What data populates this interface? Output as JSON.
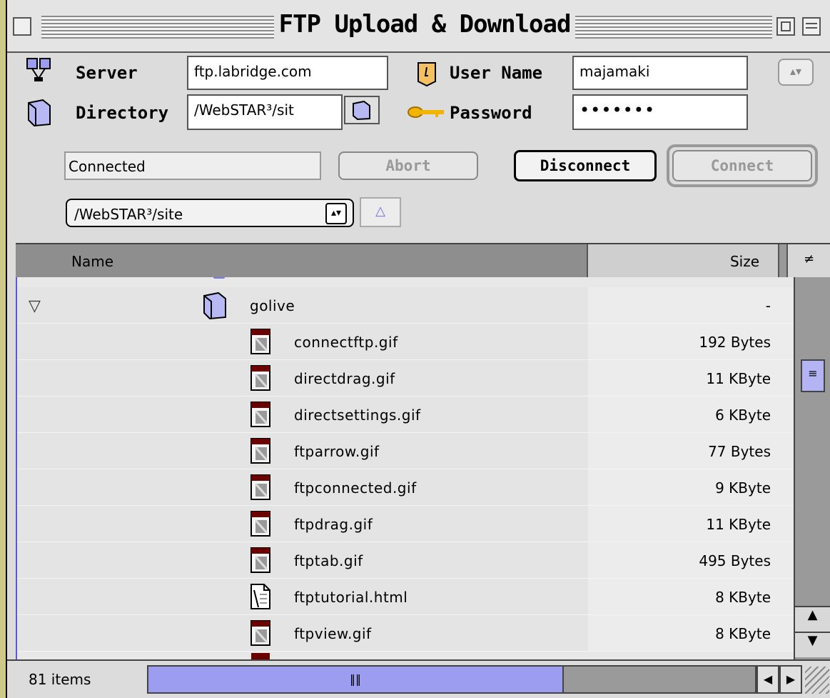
{
  "window": {
    "title": "FTP Upload & Download"
  },
  "form": {
    "server_label": "Server",
    "server_value": "ftp.labridge.com",
    "directory_label": "Directory",
    "directory_value": "/WebSTAR³/sit",
    "username_label": "User Name",
    "username_value": "majamaki",
    "password_label": "Password",
    "password_value": "•••••••"
  },
  "status_text": "Connected",
  "buttons": {
    "abort": "Abort",
    "disconnect": "Disconnect",
    "connect": "Connect"
  },
  "path_popup": "/WebSTAR³/site",
  "columns": {
    "name": "Name",
    "size": "Size"
  },
  "folder": {
    "name": "golive",
    "size": "-"
  },
  "files": [
    {
      "name": "connectftp.gif",
      "size": "192 Bytes",
      "icon": "gif-file-icon"
    },
    {
      "name": "directdrag.gif",
      "size": "11 KByte",
      "icon": "gif-file-icon"
    },
    {
      "name": "directsettings.gif",
      "size": "6 KByte",
      "icon": "gif-file-icon"
    },
    {
      "name": "ftparrow.gif",
      "size": "77 Bytes",
      "icon": "gif-file-icon"
    },
    {
      "name": "ftpconnected.gif",
      "size": "9 KByte",
      "icon": "gif-file-icon"
    },
    {
      "name": "ftpdrag.gif",
      "size": "11 KByte",
      "icon": "gif-file-icon"
    },
    {
      "name": "ftptab.gif",
      "size": "495 Bytes",
      "icon": "gif-file-icon"
    },
    {
      "name": "ftptutorial.html",
      "size": "8 KByte",
      "icon": "html-file-icon"
    },
    {
      "name": "ftpview.gif",
      "size": "8 KByte",
      "icon": "gif-file-icon"
    }
  ],
  "status_bar": {
    "items_count": "81 items"
  },
  "colors": {
    "accent": "#9c9cf0",
    "desktop": "#cfc88a"
  }
}
